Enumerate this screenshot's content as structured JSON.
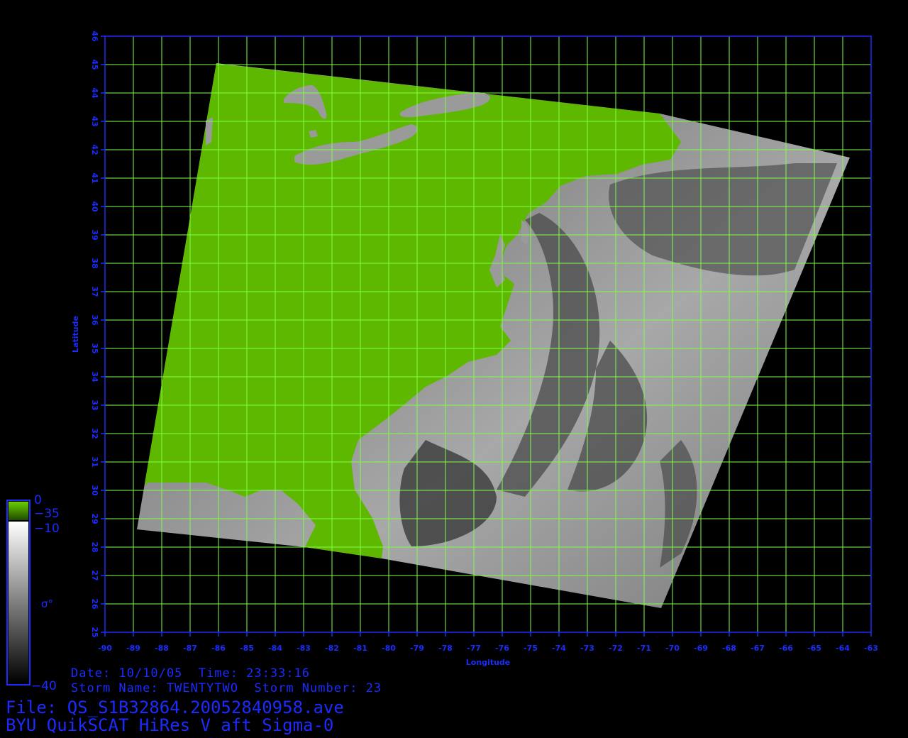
{
  "map": {
    "x_axis": {
      "label": "Longitude",
      "range": [
        -90,
        -63
      ],
      "ticks": [
        "-90",
        "-89",
        "-88",
        "-87",
        "-86",
        "-85",
        "-84",
        "-83",
        "-82",
        "-81",
        "-80",
        "-79",
        "-78",
        "-77",
        "-76",
        "-75",
        "-74",
        "-73",
        "-72",
        "-71",
        "-70",
        "-69",
        "-68",
        "-67",
        "-66",
        "-65",
        "-64",
        "-63"
      ]
    },
    "y_axis": {
      "label": "Latitude",
      "range": [
        25,
        46
      ],
      "ticks": [
        "25",
        "26",
        "27",
        "28",
        "29",
        "30",
        "31",
        "32",
        "33",
        "34",
        "35",
        "36",
        "37",
        "38",
        "39",
        "40",
        "41",
        "42",
        "43",
        "44",
        "45",
        "46"
      ]
    },
    "grid": true,
    "colors": {
      "grid": "#7cff4a",
      "axis": "#1a2cff",
      "land": "#5fb800",
      "background": "#000000"
    }
  },
  "legend": {
    "land_top": "0",
    "land_bottom": "−35",
    "sigma_top": "−10",
    "sigma_bottom": "−40",
    "symbol": "σ°"
  },
  "info": {
    "date_line": "Date: 10/10/05  Time: 23:33:16",
    "storm_line": "Storm Name: TWENTYTWO  Storm Number: 23",
    "file_line": "File: QS_S1B32864.20052840958.ave",
    "title_line": "BYU QuikSCAT HiRes V aft Sigma-0"
  }
}
